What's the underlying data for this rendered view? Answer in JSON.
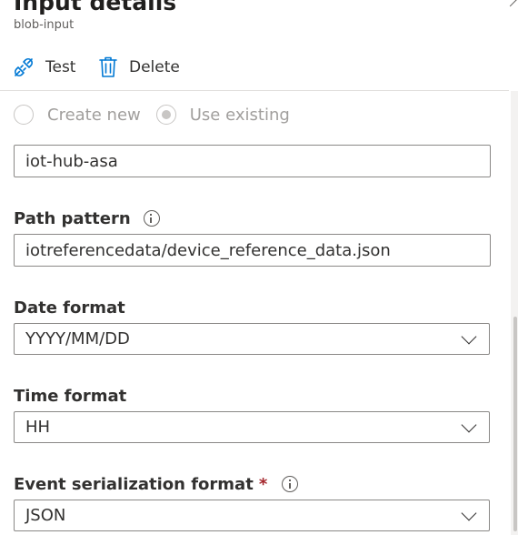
{
  "header": {
    "title": "Input details",
    "subtitle": "blob-input"
  },
  "toolbar": {
    "test_label": "Test",
    "delete_label": "Delete"
  },
  "form": {
    "radio": {
      "create_new_label": "Create new",
      "use_existing_label": "Use existing",
      "selected": "Use existing"
    },
    "storage_account_value": "iot-hub-asa",
    "path_pattern": {
      "label": "Path pattern",
      "value": "iotreferencedata/device_reference_data.json"
    },
    "date_format": {
      "label": "Date format",
      "value": "YYYY/MM/DD"
    },
    "time_format": {
      "label": "Time format",
      "value": "HH"
    },
    "event_serialization": {
      "label": "Event serialization format",
      "required_marker": "*",
      "value": "JSON"
    }
  },
  "colors": {
    "accent": "#0078d4",
    "required": "#a4262c",
    "disabled_text": "#a19f9d"
  },
  "icons": {
    "test": "plug-connection-icon",
    "delete": "trash-icon",
    "info": "info-icon",
    "dropdown": "chevron-down-icon"
  }
}
